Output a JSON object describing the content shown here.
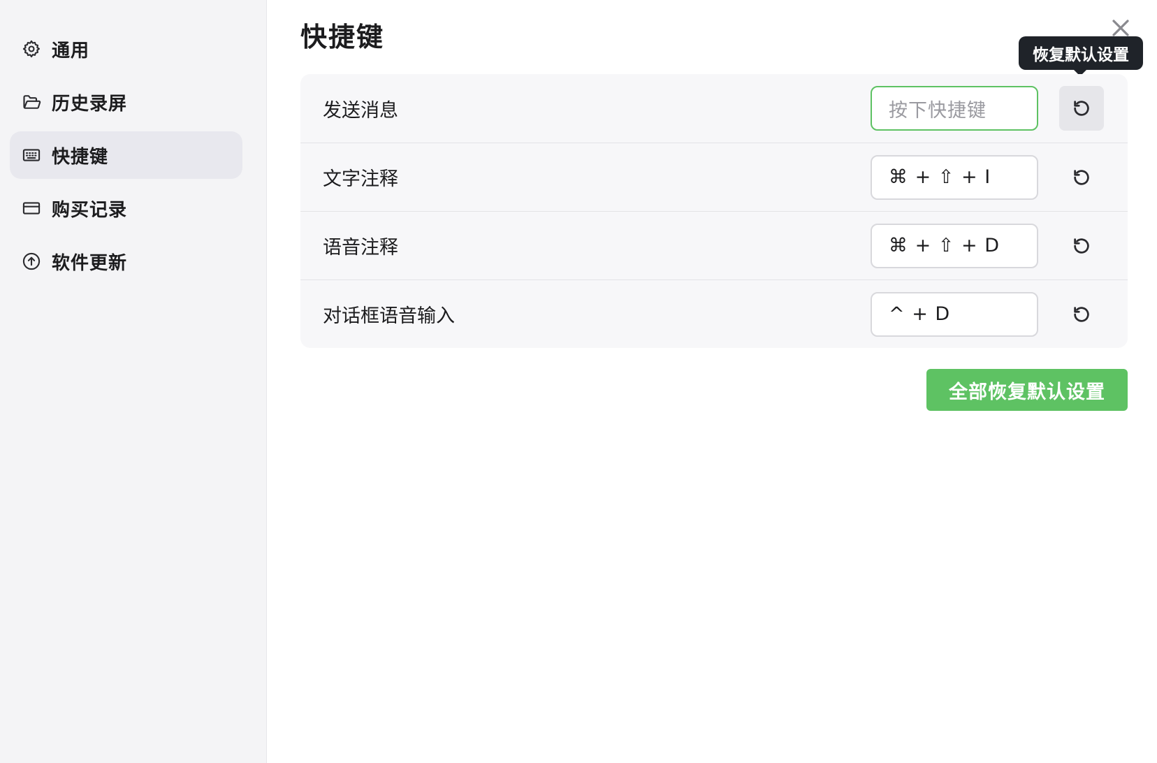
{
  "sidebar": {
    "items": [
      {
        "label": "通用",
        "icon": "gear-icon"
      },
      {
        "label": "历史录屏",
        "icon": "folder-icon"
      },
      {
        "label": "快捷键",
        "icon": "keyboard-icon",
        "active": true
      },
      {
        "label": "购买记录",
        "icon": "credit-card-icon"
      },
      {
        "label": "软件更新",
        "icon": "arrow-up-circle-icon"
      }
    ]
  },
  "main": {
    "title": "快捷键",
    "tooltip": "恢复默认设置",
    "shortcuts": [
      {
        "label": "发送消息",
        "value": "",
        "placeholder": "按下快捷键"
      },
      {
        "label": "文字注释",
        "value": "⌘ + ⇧ + I"
      },
      {
        "label": "语音注释",
        "value": "⌘ + ⇧ + D"
      },
      {
        "label": "对话框语音输入",
        "value": "^ + D"
      }
    ],
    "reset_all_label": "全部恢复默认设置"
  },
  "colors": {
    "accent": "#5ec263",
    "tooltip_bg": "#1f2329",
    "sidebar_bg": "#f4f4f6"
  }
}
